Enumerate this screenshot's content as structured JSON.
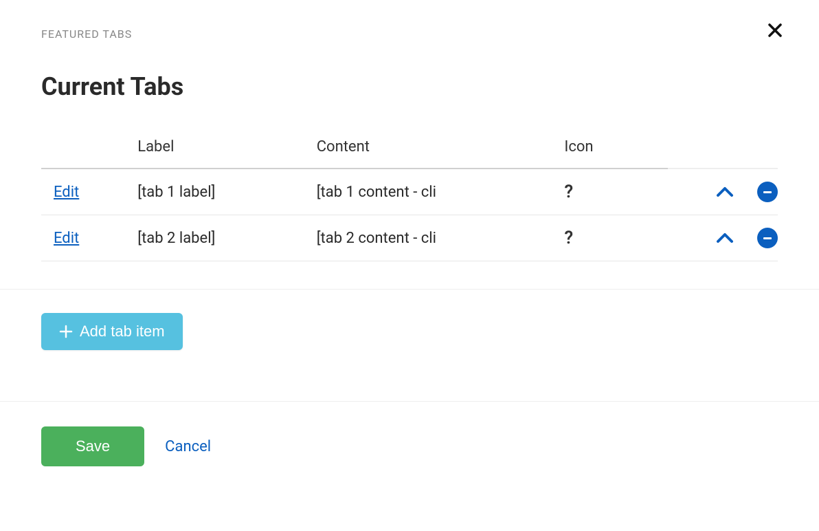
{
  "eyebrow": "FEATURED TABS",
  "title": "Current Tabs",
  "columns": {
    "label": "Label",
    "content": "Content",
    "icon": "Icon"
  },
  "edit_label": "Edit",
  "rows": [
    {
      "label": "[tab 1 label]",
      "content": "[tab 1 content - cli",
      "icon": "?"
    },
    {
      "label": "[tab 2 label]",
      "content": "[tab 2 content - cli",
      "icon": "?"
    }
  ],
  "add_button": "Add tab item",
  "save_button": "Save",
  "cancel_button": "Cancel"
}
